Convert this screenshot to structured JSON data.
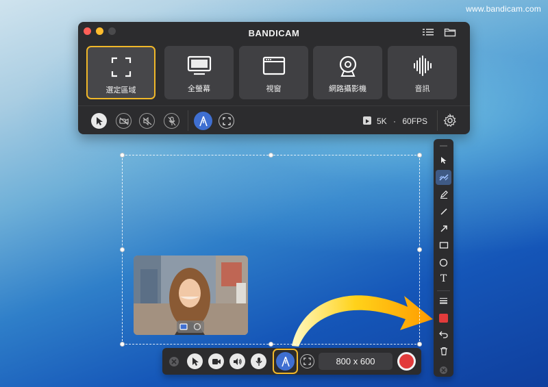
{
  "watermark": "www.bandicam.com",
  "app": {
    "title": "BANDICAM",
    "modes": [
      {
        "label": "選定區域",
        "icon": "area-select-icon",
        "selected": true
      },
      {
        "label": "全螢幕",
        "icon": "monitor-icon",
        "selected": false
      },
      {
        "label": "視窗",
        "icon": "window-icon",
        "selected": false
      },
      {
        "label": "網路攝影機",
        "icon": "webcam-icon",
        "selected": false
      },
      {
        "label": "音訊",
        "icon": "audio-wave-icon",
        "selected": false
      }
    ],
    "status": {
      "resolution": "5K",
      "separator": "·",
      "fps": "60FPS"
    }
  },
  "record_bar": {
    "size_label": "800 x 600"
  },
  "draw_toolbar": {
    "tools": [
      "pointer-icon",
      "highlighter-icon",
      "pencil-icon",
      "line-icon",
      "arrow-icon",
      "rectangle-icon",
      "ellipse-icon",
      "text-icon",
      "line-width-icon",
      "color-icon",
      "undo-icon",
      "trash-icon",
      "close-icon"
    ],
    "text_tool_label": "T",
    "active_color": "#e23b3b"
  },
  "colors": {
    "accent": "#f1b829",
    "record": "#e23b3b",
    "draw_active": "#3f6fd1"
  }
}
